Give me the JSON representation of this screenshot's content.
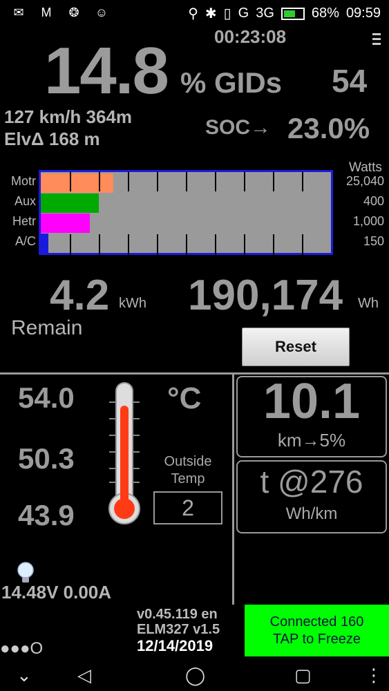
{
  "status_bar": {
    "icons": [
      "chat-icon",
      "mail-icon",
      "android-icon",
      "waze-icon",
      "location-icon",
      "bluetooth-icon",
      "vibrate-icon",
      "signal-g-icon",
      "signal-3g-icon",
      "battery-icon"
    ],
    "network_g": "G",
    "network_3g": "3G",
    "battery": "68%",
    "time": "09:59"
  },
  "trip_timer": "00:23:08",
  "charge": {
    "percent": "14.8",
    "percent_label": "% GIDs",
    "gids": "54"
  },
  "speed_line": "127 km/h 364m",
  "elevation_line": "ElvΔ 168 m",
  "soc": {
    "label": "SOC→",
    "value": "23.0%"
  },
  "power_graph": {
    "watts_label": "Watts",
    "rows": [
      {
        "label": "Motr",
        "value": "25,040",
        "fill": 0.25,
        "color": "#ff8c5a"
      },
      {
        "label": "Aux",
        "value": "400",
        "fill": 0.2,
        "color": "#00aa00"
      },
      {
        "label": "Hetr",
        "value": "1,000",
        "fill": 0.17,
        "color": "#ff00ff"
      },
      {
        "label": "A/C",
        "value": "150",
        "fill": 0.025,
        "color": "#1a1adc"
      }
    ]
  },
  "energy": {
    "remain_value": "4.2",
    "remain_unit": "kWh",
    "remain_label": "Remain",
    "used_value": "190,174",
    "used_unit": "Wh"
  },
  "reset_label": "Reset",
  "temps": {
    "t1": "54.0",
    "t2": "50.3",
    "t3": "43.9",
    "unit": "°C",
    "thermometer_fill": 0.85
  },
  "outside_temp": {
    "label_line1": "Outside",
    "label_line2": "Temp",
    "value": "2"
  },
  "range_panel": {
    "value": "10.1",
    "unit": "km→5%"
  },
  "efficiency_panel": {
    "value": "t @276",
    "unit": "Wh/km"
  },
  "battery_line": "14.48V 0.00A",
  "version": {
    "app": "v0.45.119 en",
    "elm": "ELM327 v1.5",
    "date": "12/14/2019"
  },
  "connected": {
    "line1": "Connected 160",
    "line2": "TAP to Freeze"
  },
  "dots": "●●●O"
}
